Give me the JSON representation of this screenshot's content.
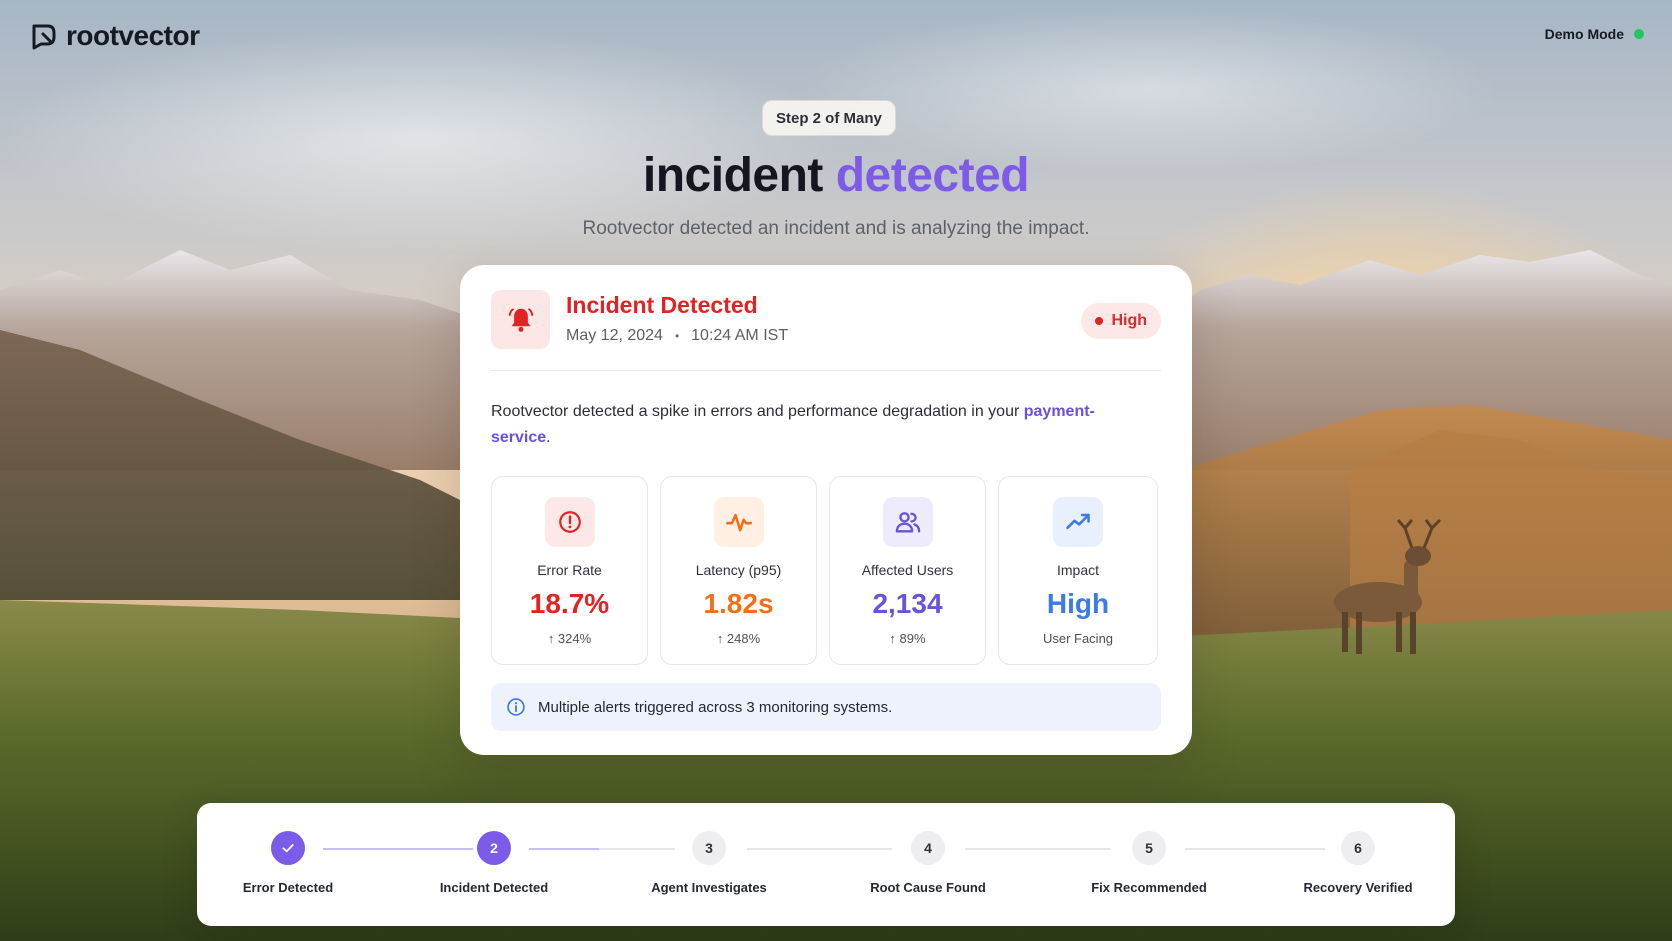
{
  "brand": {
    "name": "rootvector"
  },
  "demo": {
    "label": "Demo Mode",
    "status_color": "#22c55e"
  },
  "hero": {
    "step_pill": "Step 2 of Many",
    "title_part1": "incident",
    "title_part2": "detected",
    "subtitle": "Rootvector detected an incident and is analyzing the impact."
  },
  "incident": {
    "icon": "bell-icon",
    "title": "Incident Detected",
    "date": "May 12, 2024",
    "separator": "•",
    "time": "10:24 AM IST",
    "severity": "High",
    "description_prefix": "Rootvector detected a spike in errors and performance degradation in your",
    "service": "payment-service",
    "description_suffix": ".",
    "metrics": [
      {
        "icon": "alert-circle-icon",
        "label": "Error Rate",
        "value": "18.7%",
        "delta": "↑ 324%",
        "color": "#e02424",
        "bg": "#fde7e7"
      },
      {
        "icon": "activity-icon",
        "label": "Latency (p95)",
        "value": "1.82s",
        "delta": "↑ 248%",
        "color": "#f0701a",
        "bg": "#fff0e3"
      },
      {
        "icon": "users-icon",
        "label": "Affected Users",
        "value": "2,134",
        "delta": "↑ 89%",
        "color": "#6a52d9",
        "bg": "#eeebfc"
      },
      {
        "icon": "trending-up-icon",
        "label": "Impact",
        "value": "High",
        "delta": "User Facing",
        "color": "#3b7be6",
        "bg": "#e8f0fd"
      }
    ],
    "info": "Multiple alerts triggered across 3 monitoring systems."
  },
  "stepper": {
    "steps": [
      {
        "num": "",
        "label": "Error Detected",
        "state": "done"
      },
      {
        "num": "2",
        "label": "Incident Detected",
        "state": "active"
      },
      {
        "num": "3",
        "label": "Agent Investigates",
        "state": "pending"
      },
      {
        "num": "4",
        "label": "Root Cause Found",
        "state": "pending"
      },
      {
        "num": "5",
        "label": "Fix Recommended",
        "state": "pending"
      },
      {
        "num": "6",
        "label": "Recovery Verified",
        "state": "pending"
      }
    ]
  },
  "colors": {
    "accent": "#7c5ce6",
    "danger": "#e02424"
  }
}
